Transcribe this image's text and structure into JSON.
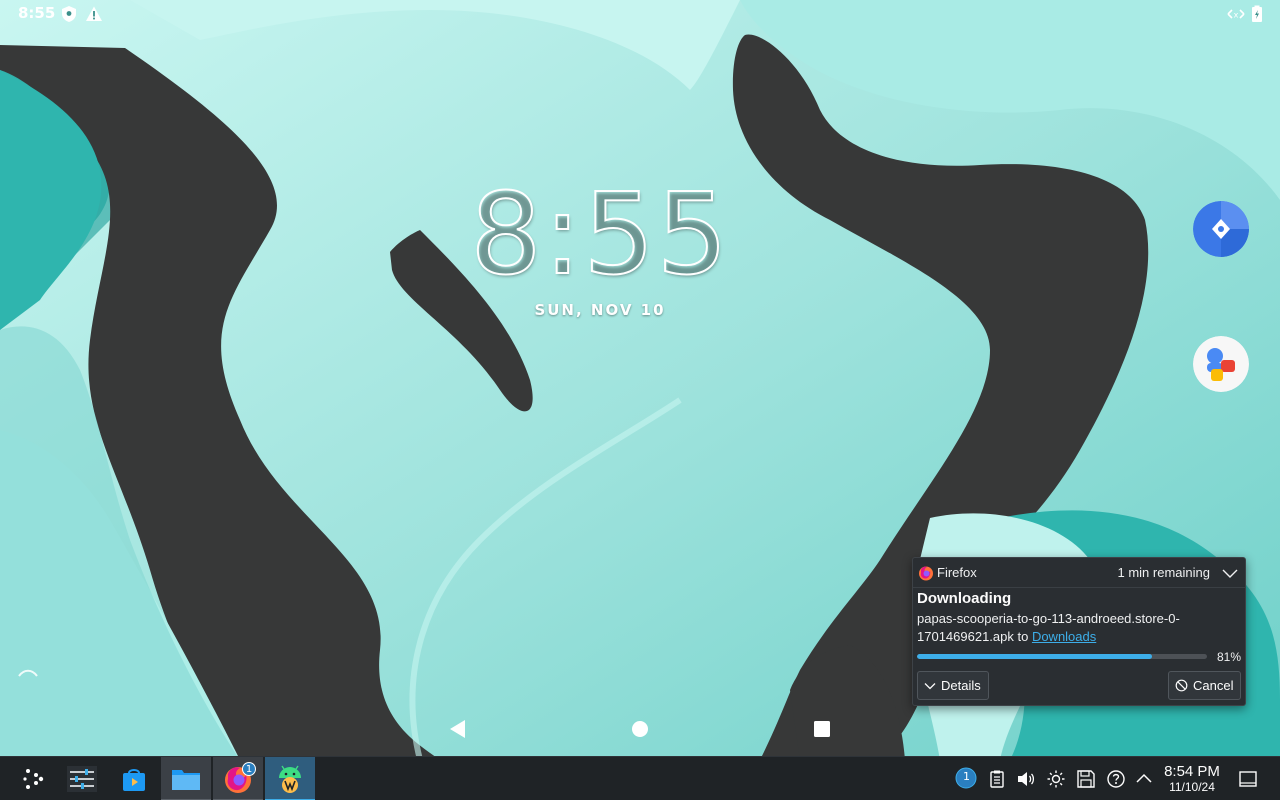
{
  "status_bar": {
    "time": "8:55",
    "icons": [
      "shield-icon",
      "alert-icon",
      "network-arrows-icon",
      "battery-icon"
    ]
  },
  "lock_screen": {
    "clock_hour": "8",
    "clock_sep": ":",
    "clock_minutes": "55",
    "date": "SUN, NOV 10"
  },
  "floating_apps": [
    "compass-app-icon",
    "contacts-app-icon"
  ],
  "android_nav": [
    "back-icon",
    "home-icon",
    "recents-icon"
  ],
  "notification": {
    "app_name": "Firefox",
    "remaining": "1 min remaining",
    "title": "Downloading",
    "filename": "papas-scooperia-to-go-113-androeed.store-0-1701469621.apk to ",
    "link_text": "Downloads",
    "progress_percent": 81,
    "progress_label": "81%",
    "details_label": "Details",
    "cancel_label": "Cancel"
  },
  "taskbar": {
    "apps": [
      "app-launcher-icon",
      "system-settings-icon",
      "discover-store-icon",
      "file-manager-icon",
      "firefox-icon",
      "waydroid-icon"
    ],
    "firefox_badge": "1",
    "tray_badge": "1",
    "tray_icons": [
      "updates-icon",
      "clipboard-icon",
      "volume-icon",
      "brightness-icon",
      "disks-icon",
      "help-icon",
      "expand-tray-icon"
    ],
    "time": "8:54 PM",
    "date": "11/10/24"
  },
  "colors": {
    "accent": "#3daee9",
    "panel": "#1f2326",
    "wallpaper_teal": "#8fded8",
    "wallpaper_dark": "#363737"
  }
}
